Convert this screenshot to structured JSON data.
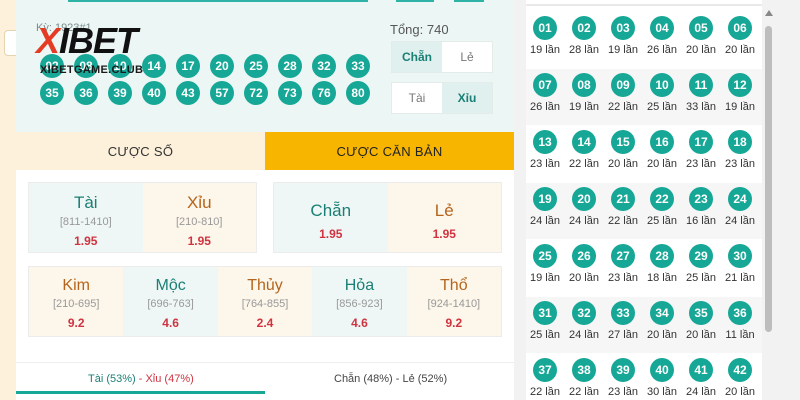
{
  "logo": {
    "brand_x": "X",
    "brand_rest": "IBET",
    "site": "XIBETGAME.CLUB"
  },
  "session_label": "Kỳ: 1923#1",
  "result_numbers": [
    "02",
    "08",
    "10",
    "14",
    "17",
    "20",
    "25",
    "28",
    "32",
    "33",
    "35",
    "36",
    "39",
    "40",
    "43",
    "57",
    "72",
    "73",
    "76",
    "80"
  ],
  "total_label": "Tổng: 740",
  "parity_toggle": {
    "left": "Chẵn",
    "right": "Lẻ",
    "selected": "left"
  },
  "size_toggle": {
    "left": "Tài",
    "right": "Xỉu",
    "selected": "right"
  },
  "tabs": {
    "numbers": "CƯỢC SỐ",
    "basic": "CƯỢC CĂN BẢN",
    "active": "basic"
  },
  "bets_taixiu": [
    {
      "name": "Tài",
      "range": "[811-1410]",
      "odds": "1.95",
      "tone": "green"
    },
    {
      "name": "Xỉu",
      "range": "[210-810]",
      "odds": "1.95",
      "tone": "cream"
    }
  ],
  "bets_chanle": [
    {
      "name": "Chẵn",
      "odds": "1.95",
      "tone": "green"
    },
    {
      "name": "Lẻ",
      "odds": "1.95",
      "tone": "cream"
    }
  ],
  "bets_elements": [
    {
      "name": "Kim",
      "range": "[210-695]",
      "odds": "9.2",
      "tone": "cream"
    },
    {
      "name": "Mộc",
      "range": "[696-763]",
      "odds": "4.6",
      "tone": "green"
    },
    {
      "name": "Thủy",
      "range": "[764-855]",
      "odds": "2.4",
      "tone": "cream"
    },
    {
      "name": "Hỏa",
      "range": "[856-923]",
      "odds": "4.6",
      "tone": "green"
    },
    {
      "name": "Thổ",
      "range": "[924-1410]",
      "odds": "9.2",
      "tone": "cream"
    }
  ],
  "stats": {
    "taixiu_a": "Tài (53%)",
    "sep": " - ",
    "taixiu_b": "Xỉu (47%)",
    "chanle": "Chẵn (48%) - Lẻ (52%)"
  },
  "frequency": [
    {
      "num": "01",
      "count": "19 lần"
    },
    {
      "num": "02",
      "count": "28 lần"
    },
    {
      "num": "03",
      "count": "19 lần"
    },
    {
      "num": "04",
      "count": "26 lần"
    },
    {
      "num": "05",
      "count": "20 lần"
    },
    {
      "num": "06",
      "count": "20 lần"
    },
    {
      "num": "07",
      "count": "26 lần"
    },
    {
      "num": "08",
      "count": "19 lần"
    },
    {
      "num": "09",
      "count": "22 lần"
    },
    {
      "num": "10",
      "count": "25 lần"
    },
    {
      "num": "11",
      "count": "33 lần"
    },
    {
      "num": "12",
      "count": "19 lần"
    },
    {
      "num": "13",
      "count": "23 lần"
    },
    {
      "num": "14",
      "count": "22 lần"
    },
    {
      "num": "15",
      "count": "20 lần"
    },
    {
      "num": "16",
      "count": "20 lần"
    },
    {
      "num": "17",
      "count": "23 lần"
    },
    {
      "num": "18",
      "count": "23 lần"
    },
    {
      "num": "19",
      "count": "24 lần"
    },
    {
      "num": "20",
      "count": "24 lần"
    },
    {
      "num": "21",
      "count": "22 lần"
    },
    {
      "num": "22",
      "count": "25 lần"
    },
    {
      "num": "23",
      "count": "16 lần"
    },
    {
      "num": "24",
      "count": "24 lần"
    },
    {
      "num": "25",
      "count": "19 lần"
    },
    {
      "num": "26",
      "count": "20 lần"
    },
    {
      "num": "27",
      "count": "23 lần"
    },
    {
      "num": "28",
      "count": "18 lần"
    },
    {
      "num": "29",
      "count": "25 lần"
    },
    {
      "num": "30",
      "count": "21 lần"
    },
    {
      "num": "31",
      "count": "25 lần"
    },
    {
      "num": "32",
      "count": "24 lần"
    },
    {
      "num": "33",
      "count": "27 lần"
    },
    {
      "num": "34",
      "count": "20 lần"
    },
    {
      "num": "35",
      "count": "20 lần"
    },
    {
      "num": "36",
      "count": "11 lần"
    },
    {
      "num": "37",
      "count": "22 lần"
    },
    {
      "num": "38",
      "count": "22 lần"
    },
    {
      "num": "39",
      "count": "23 lần"
    },
    {
      "num": "40",
      "count": "30 lần"
    },
    {
      "num": "41",
      "count": "24 lần"
    },
    {
      "num": "42",
      "count": "20 lần"
    }
  ],
  "colors": {
    "accent": "#16a796",
    "gold": "#f7b500",
    "cream": "#fdf1dc",
    "odds": "#d03340",
    "brand_red": "#e53b25"
  }
}
